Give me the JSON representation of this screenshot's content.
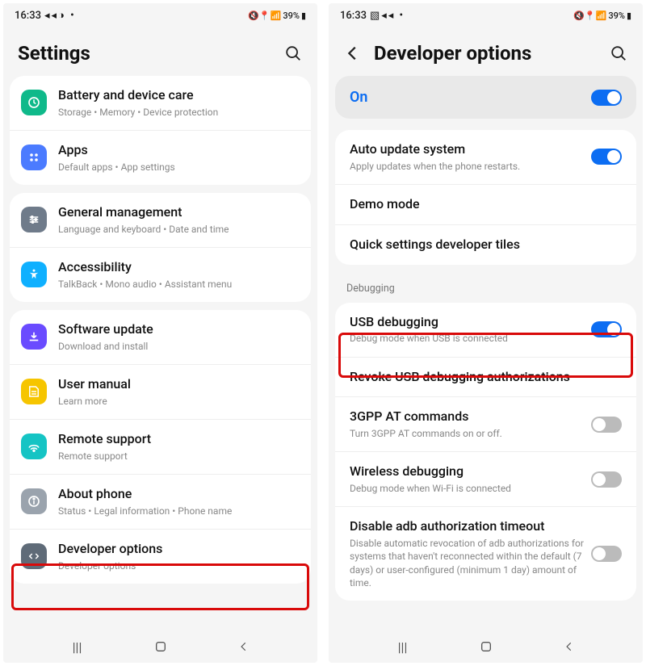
{
  "statusbar": {
    "time": "16:33",
    "battery": "39%"
  },
  "left": {
    "title": "Settings",
    "groups": [
      [
        {
          "icon": "battery",
          "bg": "#0fb98a",
          "title": "Battery and device care",
          "sub": "Storage  •  Memory  •  Device protection"
        },
        {
          "icon": "apps",
          "bg": "#4b7bff",
          "title": "Apps",
          "sub": "Default apps  •  App settings"
        }
      ],
      [
        {
          "icon": "general",
          "bg": "#6f7b8a",
          "title": "General management",
          "sub": "Language and keyboard  •  Date and time"
        },
        {
          "icon": "accessibility",
          "bg": "#0fb0ff",
          "title": "Accessibility",
          "sub": "TalkBack  •  Mono audio  •  Assistant menu"
        }
      ],
      [
        {
          "icon": "update",
          "bg": "#6a4bff",
          "title": "Software update",
          "sub": "Download and install"
        },
        {
          "icon": "manual",
          "bg": "#f6c500",
          "title": "User manual",
          "sub": "Learn more"
        },
        {
          "icon": "remote",
          "bg": "#15c4c4",
          "title": "Remote support",
          "sub": "Remote support"
        },
        {
          "icon": "about",
          "bg": "#9aa3ad",
          "title": "About phone",
          "sub": "Status  •  Legal information  •  Phone name"
        },
        {
          "icon": "dev",
          "bg": "#5f6b78",
          "title": "Developer options",
          "sub": "Developer options"
        }
      ]
    ]
  },
  "right": {
    "title": "Developer options",
    "master": {
      "label": "On",
      "on": true
    },
    "groups": [
      {
        "section": null,
        "items": [
          {
            "title": "Auto update system",
            "sub": "Apply updates when the phone restarts.",
            "toggle": true
          },
          {
            "title": "Demo mode",
            "sub": null,
            "toggle": null
          },
          {
            "title": "Quick settings developer tiles",
            "sub": null,
            "toggle": null
          }
        ]
      },
      {
        "section": "Debugging",
        "items": [
          {
            "title": "USB debugging",
            "sub": "Debug mode when USB is connected",
            "toggle": true
          },
          {
            "title": "Revoke USB debugging authorizations",
            "sub": null,
            "toggle": null
          },
          {
            "title": "3GPP AT commands",
            "sub": "Turn 3GPP AT commands on or off.",
            "toggle": false
          },
          {
            "title": "Wireless debugging",
            "sub": "Debug mode when Wi-Fi is connected",
            "toggle": false
          },
          {
            "title": "Disable adb authorization timeout",
            "sub": "Disable automatic revocation of adb authorizations for systems that haven't reconnected within the default (7 days) or user-configured (minimum 1 day) amount of time.",
            "toggle": false
          }
        ]
      }
    ]
  }
}
